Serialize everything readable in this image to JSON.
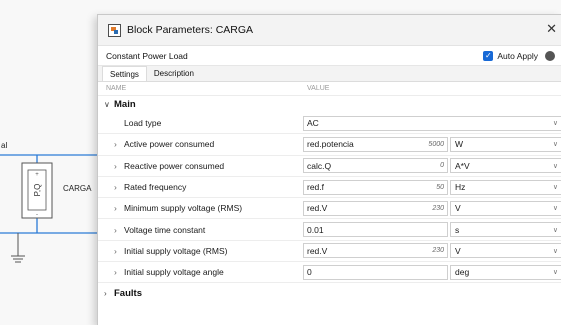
{
  "canvas": {
    "left_label": "al",
    "block_label": "CARGA"
  },
  "dialog": {
    "title": "Block Parameters: CARGA",
    "block_type": "Constant Power Load",
    "auto_apply_label": "Auto Apply",
    "tabs": [
      "Settings",
      "Description"
    ],
    "columns": {
      "name": "NAME",
      "value": "VALUE"
    },
    "sections": {
      "main": "Main",
      "faults": "Faults"
    },
    "params": [
      {
        "name": "Load type",
        "value": "AC",
        "eval": "",
        "unit": "",
        "expand": false,
        "kind": "select"
      },
      {
        "name": "Active power consumed",
        "value": "red.potencia",
        "eval": "5000",
        "unit": "W",
        "expand": true,
        "kind": "unit"
      },
      {
        "name": "Reactive power consumed",
        "value": "calc.Q",
        "eval": "0",
        "unit": "A*V",
        "expand": true,
        "kind": "unit"
      },
      {
        "name": "Rated frequency",
        "value": "red.f",
        "eval": "50",
        "unit": "Hz",
        "expand": true,
        "kind": "unit"
      },
      {
        "name": "Minimum supply voltage (RMS)",
        "value": "red.V",
        "eval": "230",
        "unit": "V",
        "expand": true,
        "kind": "unit"
      },
      {
        "name": "Voltage time constant",
        "value": "0.01",
        "eval": "",
        "unit": "s",
        "expand": true,
        "kind": "unit"
      },
      {
        "name": "Initial supply voltage (RMS)",
        "value": "red.V",
        "eval": "230",
        "unit": "V",
        "expand": true,
        "kind": "unit"
      },
      {
        "name": "Initial supply voltage angle",
        "value": "0",
        "eval": "",
        "unit": "deg",
        "expand": true,
        "kind": "unit"
      }
    ]
  },
  "colors": {
    "accent": "#1769d6",
    "wire": "#2b7bd6"
  }
}
